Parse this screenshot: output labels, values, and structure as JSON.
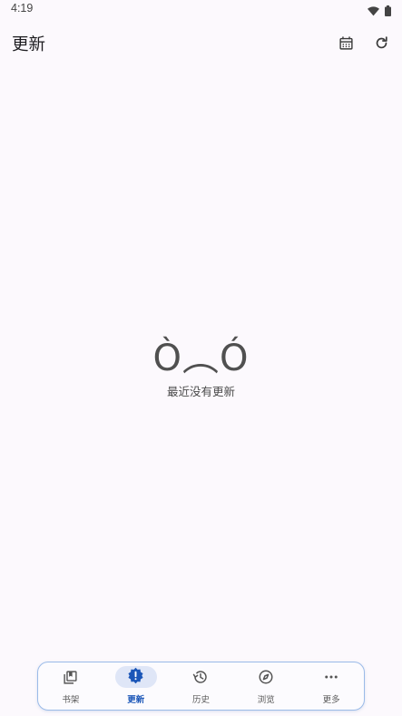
{
  "status_bar": {
    "time": "4:19",
    "icons": [
      "wifi-icon",
      "battery-icon"
    ]
  },
  "header": {
    "title": "更新",
    "actions": [
      {
        "icon": "calendar-icon"
      },
      {
        "icon": "refresh-icon"
      }
    ]
  },
  "empty_state": {
    "face": "Ò︵Ó",
    "message": "最近没有更新"
  },
  "bottom_nav": {
    "items": [
      {
        "label": "书架",
        "icon": "library-icon",
        "active": false
      },
      {
        "label": "更新",
        "icon": "new-releases-icon",
        "active": true
      },
      {
        "label": "历史",
        "icon": "history-icon",
        "active": false
      },
      {
        "label": "浏览",
        "icon": "compass-icon",
        "active": false
      },
      {
        "label": "更多",
        "icon": "more-horiz-icon",
        "active": false
      }
    ]
  },
  "colors": {
    "accent": "#1c57b8",
    "active_pill": "#dfe6f7",
    "nav_border": "#9bbbe8",
    "background": "#fcf9fd"
  }
}
